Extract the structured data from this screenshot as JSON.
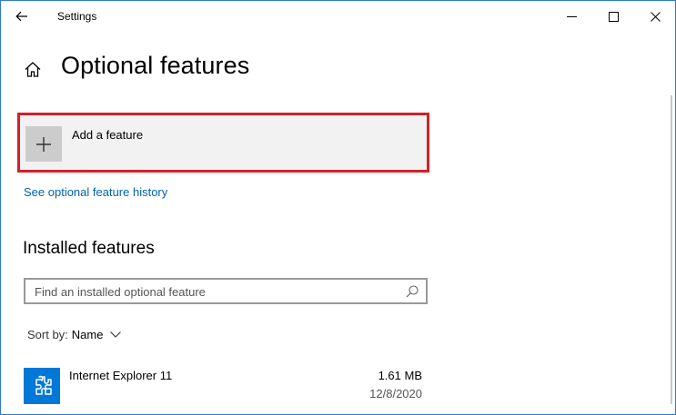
{
  "window": {
    "title": "Settings"
  },
  "header": {
    "title": "Optional features"
  },
  "add_feature": {
    "label": "Add a feature"
  },
  "links": {
    "history": "See optional feature history"
  },
  "installed": {
    "heading": "Installed features",
    "search_placeholder": "Find an installed optional feature",
    "sort_label": "Sort by:",
    "sort_value": "Name",
    "items": [
      {
        "name": "Internet Explorer 11",
        "size": "1.61 MB",
        "date": "12/8/2020"
      }
    ]
  },
  "colors": {
    "accent": "#0078d7",
    "link": "#0063b1",
    "highlight_border": "#d0212b"
  },
  "icons": [
    "back-arrow-icon",
    "minimize-icon",
    "maximize-icon",
    "close-icon",
    "home-icon",
    "plus-icon",
    "search-icon",
    "chevron-down-icon",
    "puzzle-icon"
  ]
}
